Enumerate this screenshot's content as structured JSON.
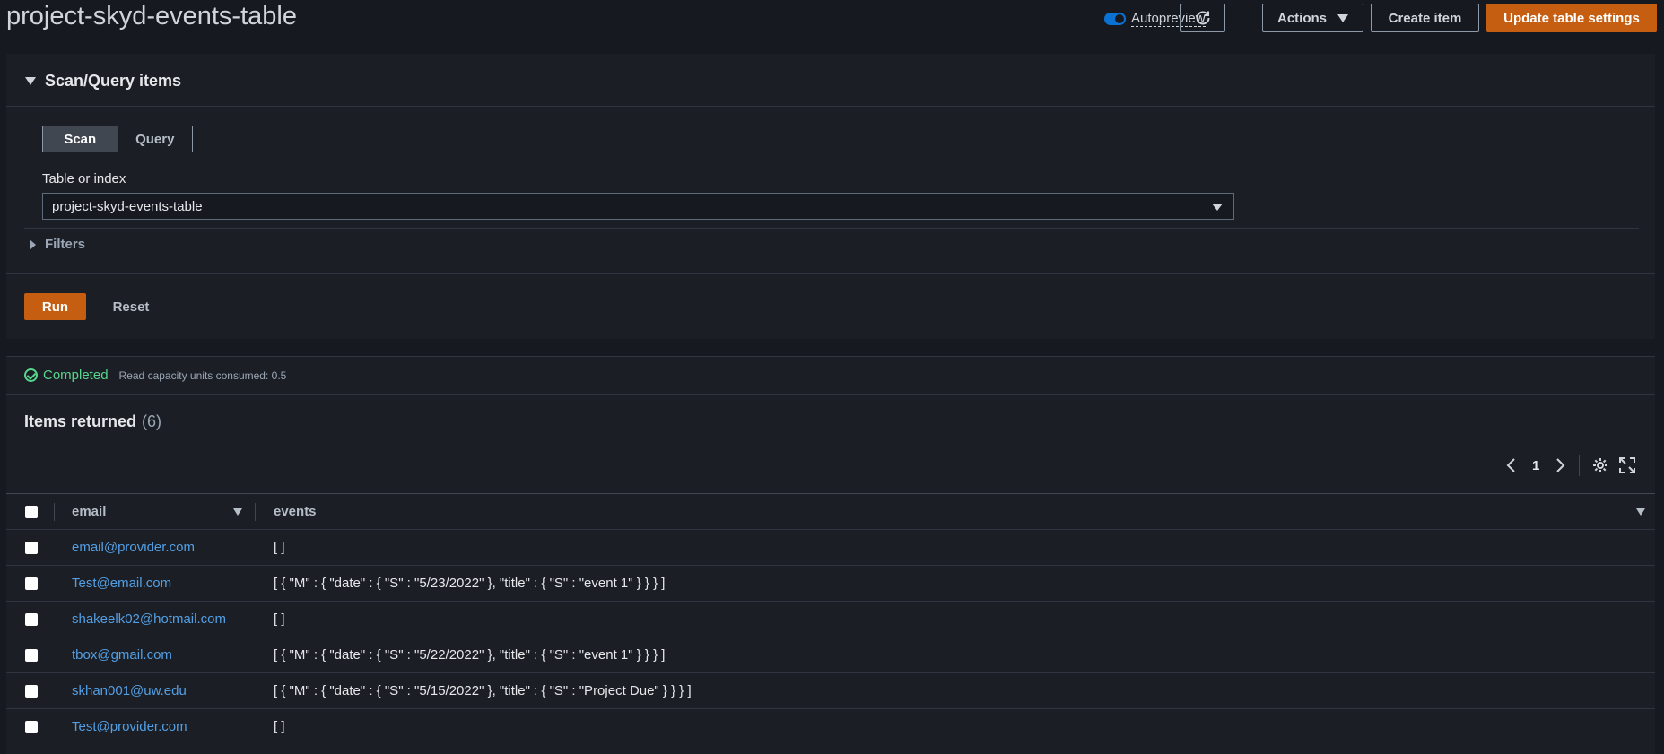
{
  "header": {
    "title": "project-skyd-events-table",
    "autopreview_label": "Autopreview",
    "actions_label": "Actions",
    "create_label": "Create item",
    "update_label": "Update table settings"
  },
  "scan_panel": {
    "title": "Scan/Query items",
    "tabs": [
      {
        "label": "Scan",
        "active": true
      },
      {
        "label": "Query",
        "active": false
      }
    ],
    "table_label": "Table or index",
    "table_value": "project-skyd-events-table",
    "filters_label": "Filters",
    "run_label": "Run",
    "reset_label": "Reset"
  },
  "status": {
    "state": "Completed",
    "detail": "Read capacity units consumed: 0.5"
  },
  "results": {
    "title": "Items returned",
    "count": "(6)",
    "page": "1",
    "columns": [
      "email",
      "events"
    ],
    "rows": [
      {
        "email": "email@provider.com",
        "events": "[ ]"
      },
      {
        "email": "Test@email.com",
        "events": "[ { \"M\" : { \"date\" : { \"S\" : \"5/23/2022\" }, \"title\" : { \"S\" : \"event 1\" } } } ]"
      },
      {
        "email": "shakeelk02@hotmail.com",
        "events": "[ ]"
      },
      {
        "email": "tbox@gmail.com",
        "events": "[ { \"M\" : { \"date\" : { \"S\" : \"5/22/2022\" }, \"title\" : { \"S\" : \"event 1\" } } } ]"
      },
      {
        "email": "skhan001@uw.edu",
        "events": "[ { \"M\" : { \"date\" : { \"S\" : \"5/15/2022\" }, \"title\" : { \"S\" : \"Project Due\" } } } ]"
      },
      {
        "email": "Test@provider.com",
        "events": "[ ]"
      }
    ]
  },
  "colors": {
    "accent": "#c65e12",
    "link": "#539fe5",
    "success": "#58d68d",
    "background": "#16191f"
  }
}
